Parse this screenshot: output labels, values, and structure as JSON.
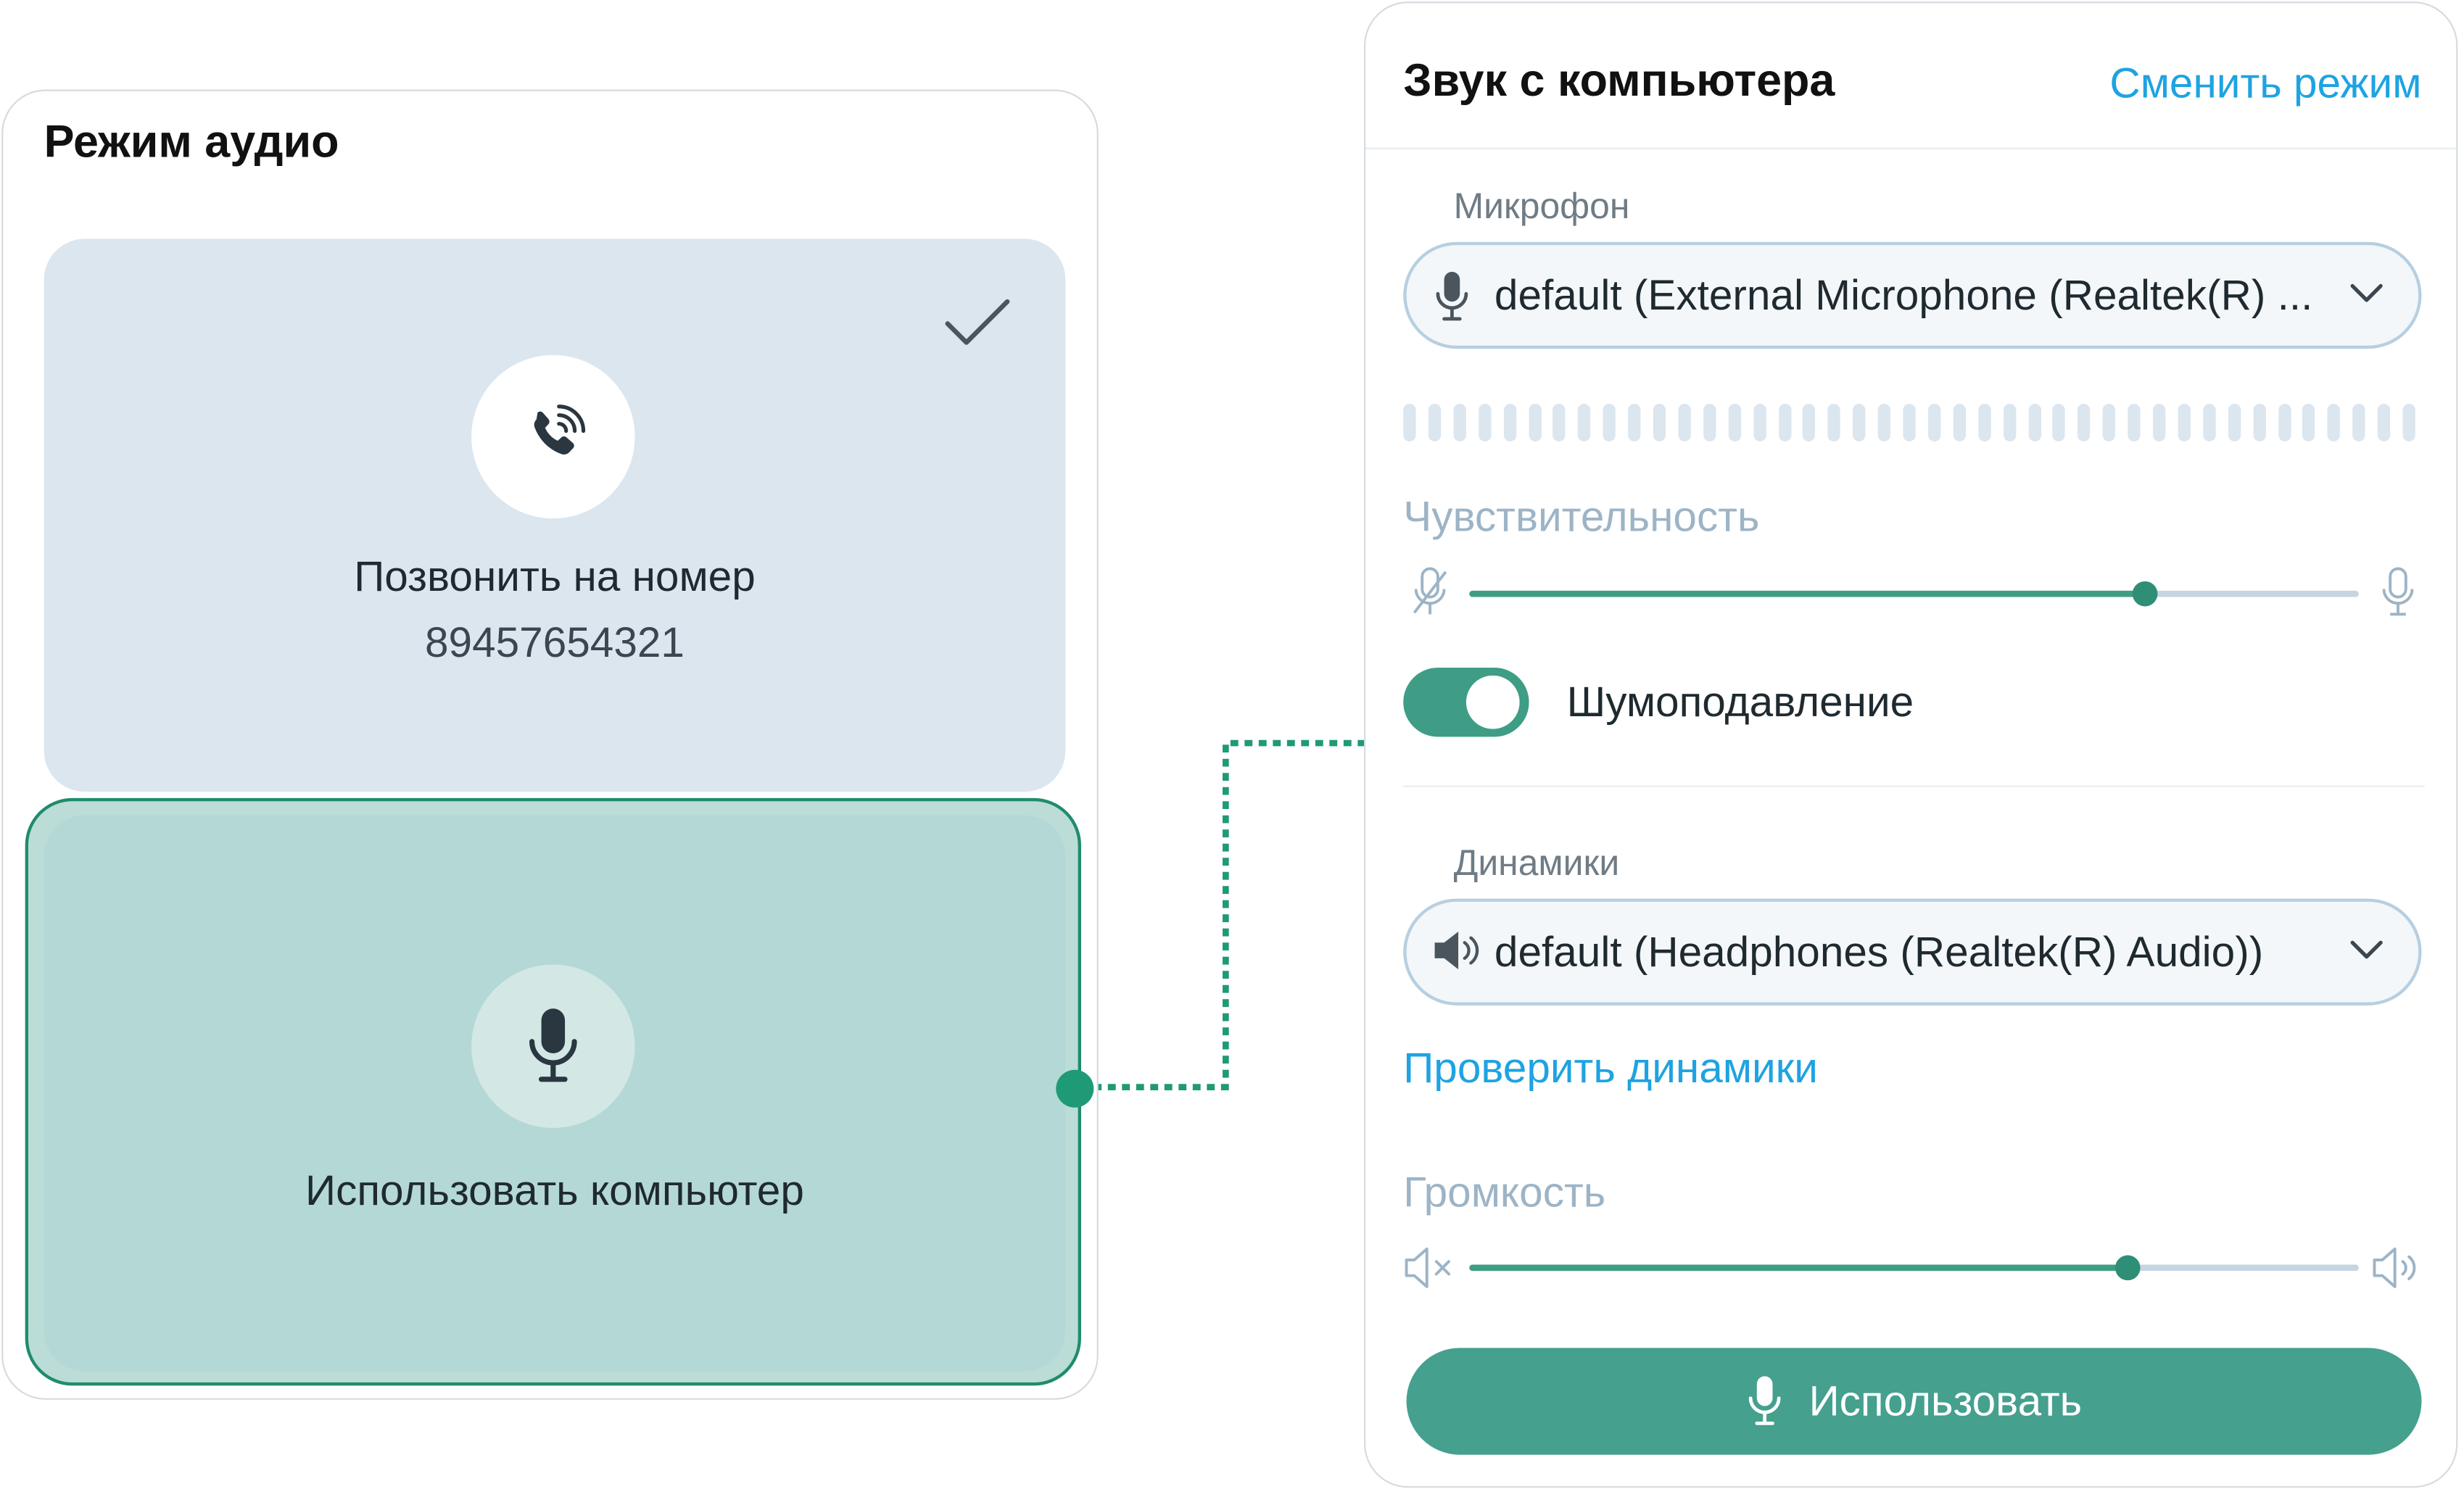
{
  "audio_mode": {
    "title": "Режим аудио",
    "phone_option": {
      "label": "Позвонить на номер",
      "number": "89457654321",
      "selected": true
    },
    "computer_option": {
      "label": "Использовать компьютер",
      "highlighted": true
    }
  },
  "computer_audio": {
    "title": "Звук с компьютера",
    "switch_mode_link": "Сменить режим",
    "microphone": {
      "label": "Микрофон",
      "selected_value": "default (External Microphone (Realtek(R) ..."
    },
    "sensitivity": {
      "label": "Чувствительность",
      "level_percent": 76
    },
    "noise_suppression": {
      "label": "Шумоподавление",
      "enabled": true
    },
    "speakers": {
      "label": "Динамики",
      "selected_value": "default (Headphones (Realtek(R) Audio))"
    },
    "test_speakers_link": "Проверить динамики",
    "volume": {
      "label": "Громкость",
      "level_percent": 74
    },
    "use_button": "Использовать"
  },
  "colors": {
    "accent_green": "#45a08e",
    "link_blue": "#1ea3e2",
    "selected_frame": "#1f8c6c",
    "phone_card_bg": "#dce6ef",
    "computer_card_bg": "#b4d8d6"
  },
  "icons": [
    "phone-ringing-icon",
    "checkmark-icon",
    "microphone-icon",
    "chevron-down-icon",
    "speaker-icon",
    "microphone-muted-icon",
    "speaker-muted-icon",
    "speaker-loud-icon"
  ]
}
